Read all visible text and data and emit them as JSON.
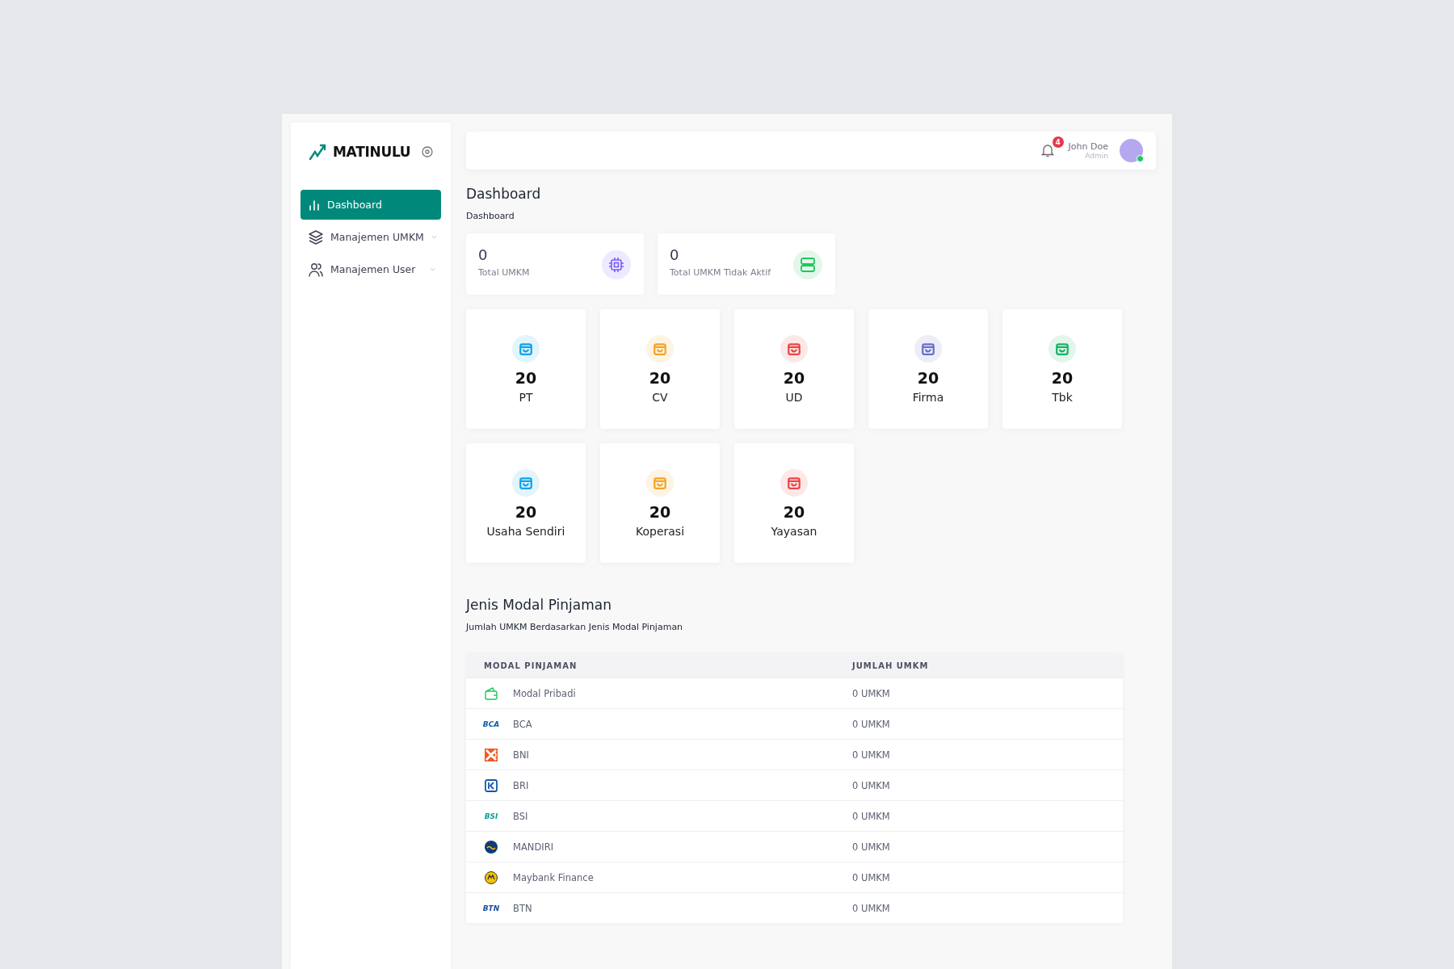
{
  "brand": {
    "name": "MATINULU"
  },
  "sidebar": {
    "items": [
      {
        "label": "Dashboard",
        "selected": true,
        "has_submenu": false
      },
      {
        "label": "Manajemen UMKM",
        "selected": false,
        "has_submenu": true
      },
      {
        "label": "Manajemen User",
        "selected": false,
        "has_submenu": true
      }
    ]
  },
  "header": {
    "notifications": "4",
    "user": {
      "name": "John Doe",
      "role": "Admin",
      "online": true
    }
  },
  "page": {
    "title": "Dashboard",
    "breadcrumb": "Dashboard"
  },
  "summary": [
    {
      "value": "0",
      "label": "Total UMKM",
      "color": "#7c5cf6"
    },
    {
      "value": "0",
      "label": "Total UMKM Tidak Aktif",
      "color": "#22c55e"
    }
  ],
  "categories": [
    {
      "value": "20",
      "label": "PT",
      "color": "#0ea5e9"
    },
    {
      "value": "20",
      "label": "CV",
      "color": "#f5a524"
    },
    {
      "value": "20",
      "label": "UD",
      "color": "#ef4444"
    },
    {
      "value": "20",
      "label": "Firma",
      "color": "#6b6fc8"
    },
    {
      "value": "20",
      "label": "Tbk",
      "color": "#16b364"
    },
    {
      "value": "20",
      "label": "Usaha Sendiri",
      "color": "#0ea5e9"
    },
    {
      "value": "20",
      "label": "Koperasi",
      "color": "#f5a524"
    },
    {
      "value": "20",
      "label": "Yayasan",
      "color": "#ef4444"
    }
  ],
  "loans": {
    "title": "Jenis Modal Pinjaman",
    "subtitle": "Jumlah UMKM Berdasarkan Jenis Modal Pinjaman",
    "columns": [
      "MODAL PINJAMAN",
      "JUMLAH UMKM"
    ],
    "rows": [
      {
        "kind": "wallet",
        "name": "Modal Pribadi",
        "count": "0 UMKM"
      },
      {
        "kind": "wordmark",
        "logo_text": "BCA",
        "color": "#0b5fb0",
        "name": "BCA",
        "count": "0 UMKM"
      },
      {
        "kind": "cross",
        "name": "BNI",
        "count": "0 UMKM"
      },
      {
        "kind": "square",
        "name": "BRI",
        "count": "0 UMKM"
      },
      {
        "kind": "wordmark",
        "logo_text": "BSI",
        "color": "#0aa39a",
        "name": "BSI",
        "count": "0 UMKM"
      },
      {
        "kind": "wave",
        "name": "MANDIRI",
        "count": "0 UMKM"
      },
      {
        "kind": "emblem",
        "name": "Maybank Finance",
        "count": "0 UMKM"
      },
      {
        "kind": "wordmark",
        "logo_text": "BTN",
        "color": "#1d4fa0",
        "name": "BTN",
        "count": "0 UMKM"
      }
    ]
  }
}
